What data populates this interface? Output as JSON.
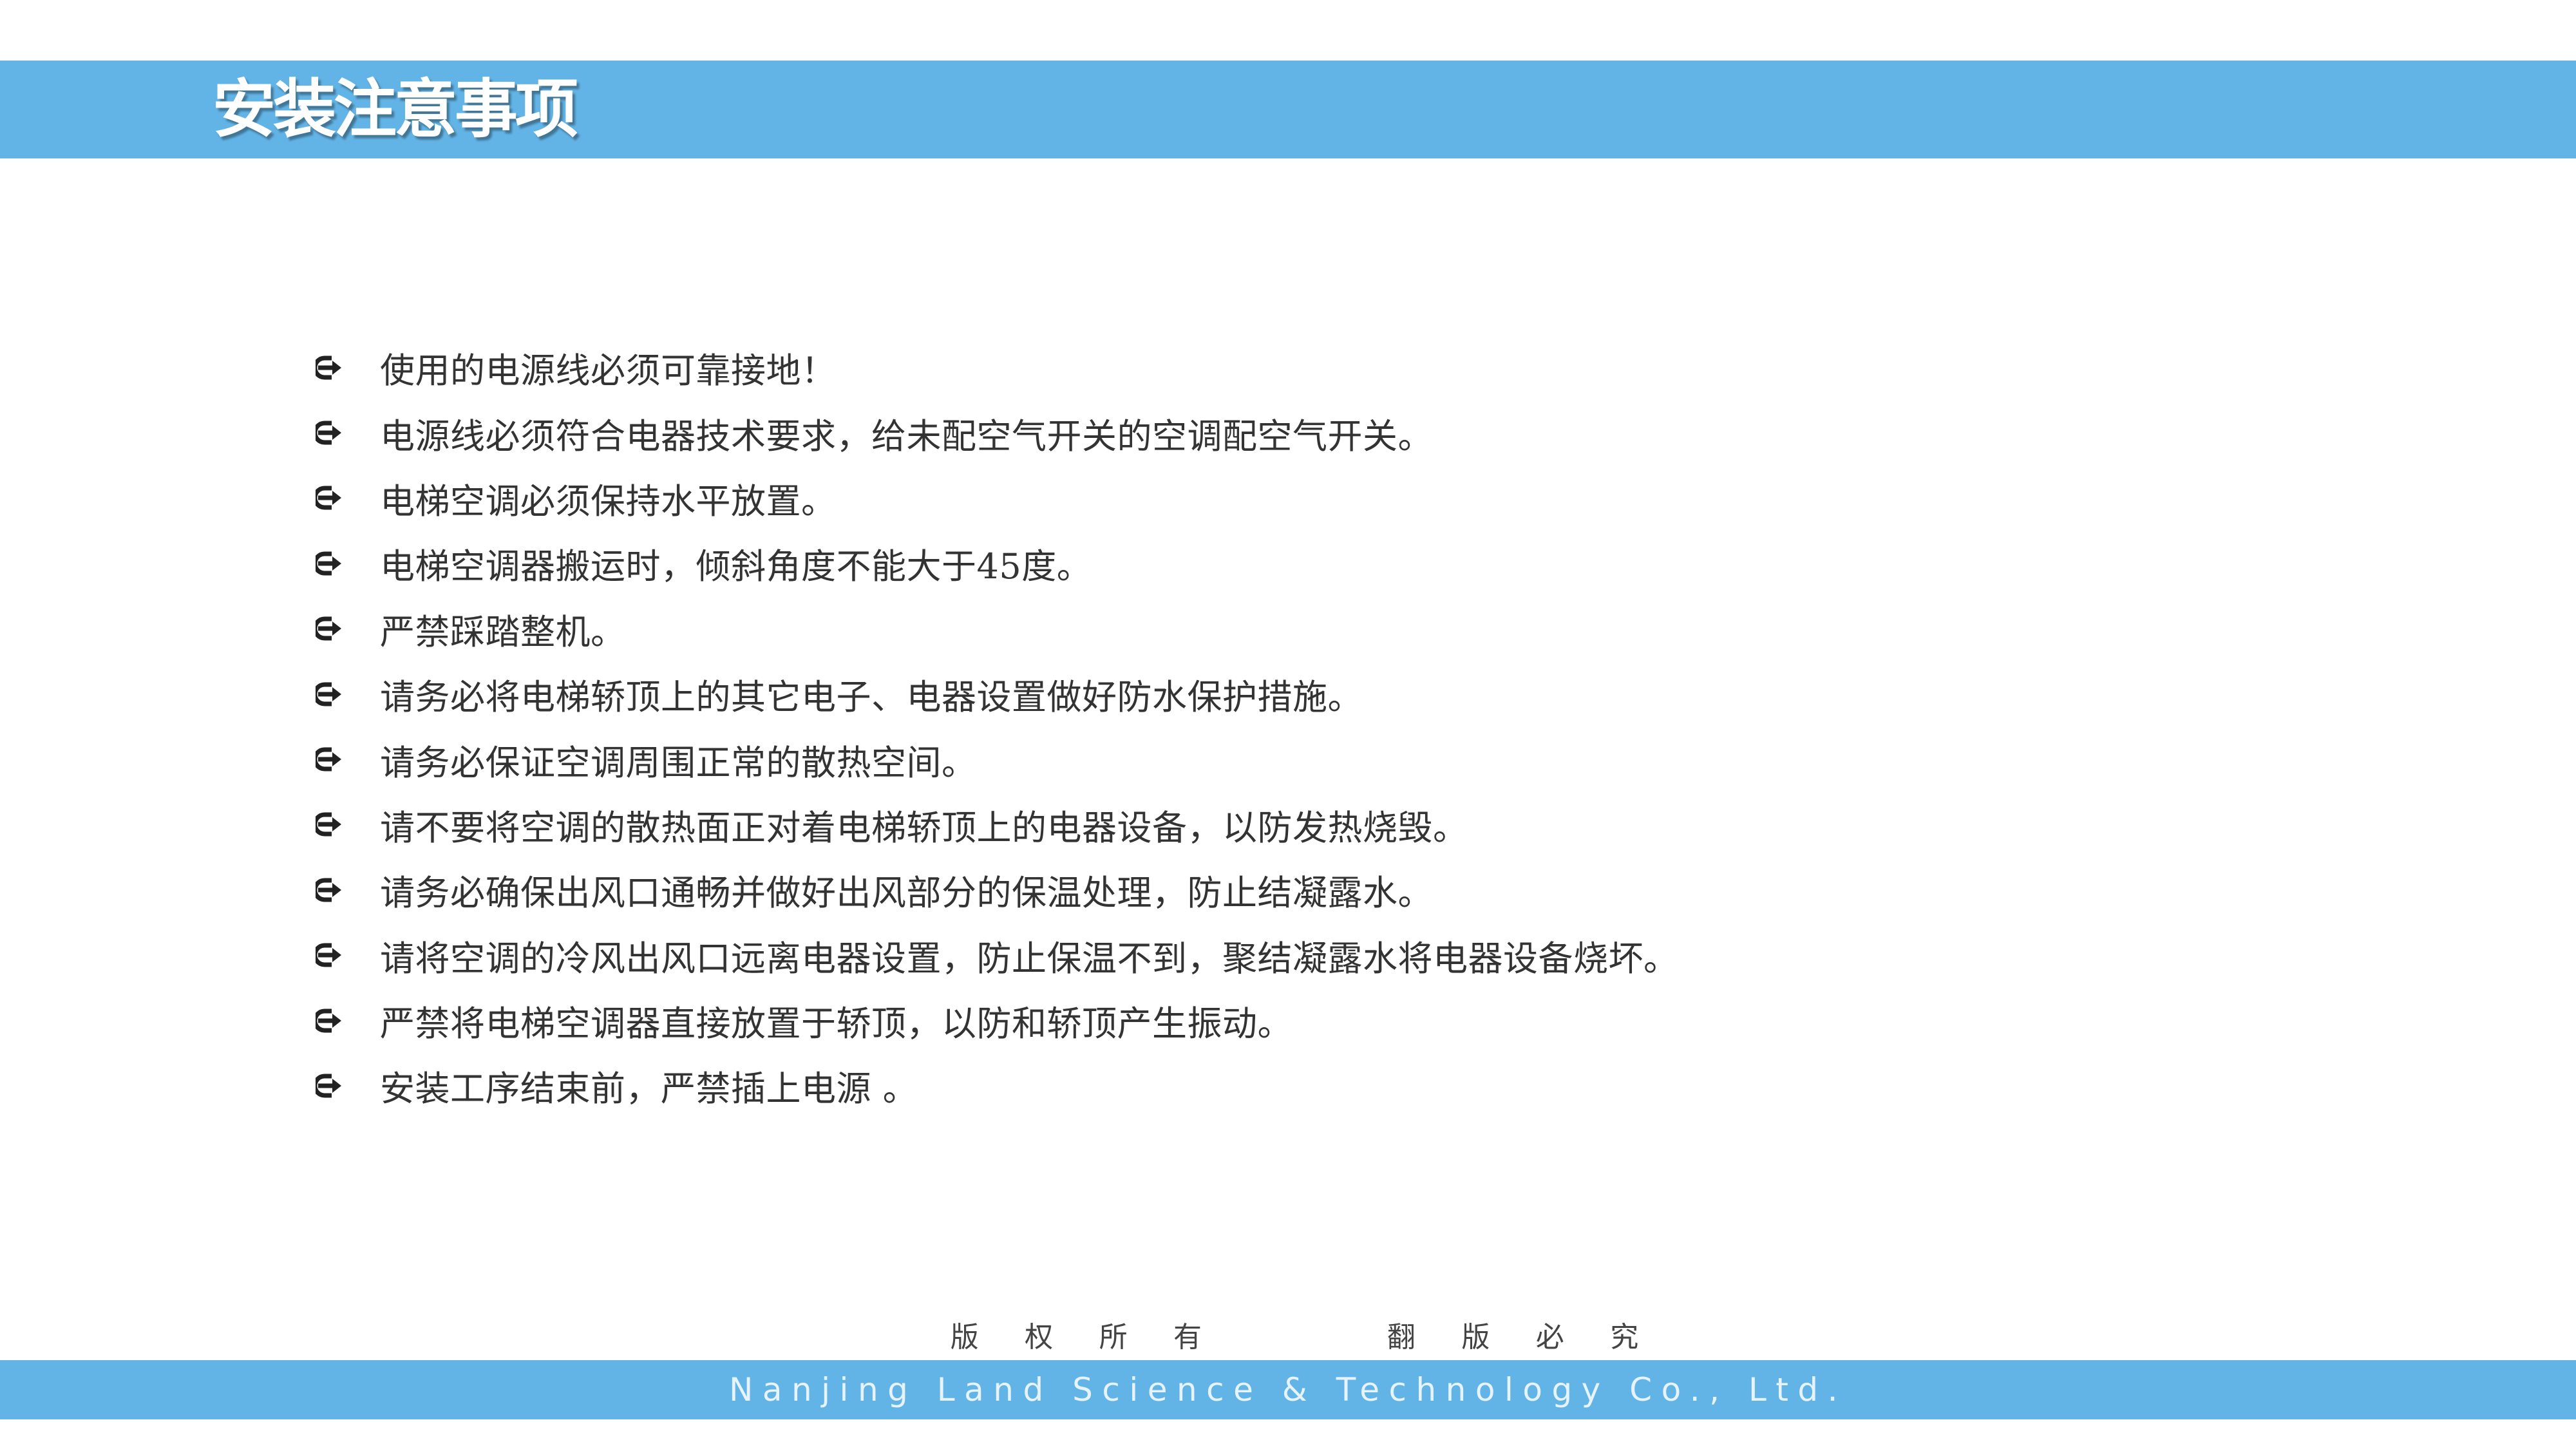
{
  "header": {
    "title": "安装注意事项"
  },
  "notes": [
    "使用的电源线必须可靠接地！",
    "电源线必须符合电器技术要求，给未配空气开关的空调配空气开关。",
    "电梯空调必须保持水平放置。",
    "电梯空调器搬运时，倾斜角度不能大于45度。",
    "严禁踩踏整机。",
    "请务必将电梯轿顶上的其它电子、电器设置做好防水保护措施。",
    "请务必保证空调周围正常的散热空间。",
    "请不要将空调的散热面正对着电梯轿顶上的电器设备，以防发热烧毁。",
    "请务必确保出风口通畅并做好出风部分的保温处理，防止结凝露水。",
    "请将空调的冷风出风口远离电器设置，防止保温不到，聚结凝露水将电器设备烧坏。",
    "严禁将电梯空调器直接放置于轿顶，以防和轿顶产生振动。",
    "安装工序结束前，严禁插上电源 。"
  ],
  "bullet_icon": "right-arrow-circle-icon",
  "footer": {
    "copyright_chars": [
      "版",
      "权",
      "所",
      "有",
      "翻",
      "版",
      "必",
      "究"
    ],
    "company": "Nanjing Land Science & Technology Co., Ltd."
  },
  "colors": {
    "accent": "#63b4e6",
    "title_text": "#ffffff",
    "body_text": "#333333",
    "bullet": "#222222"
  }
}
